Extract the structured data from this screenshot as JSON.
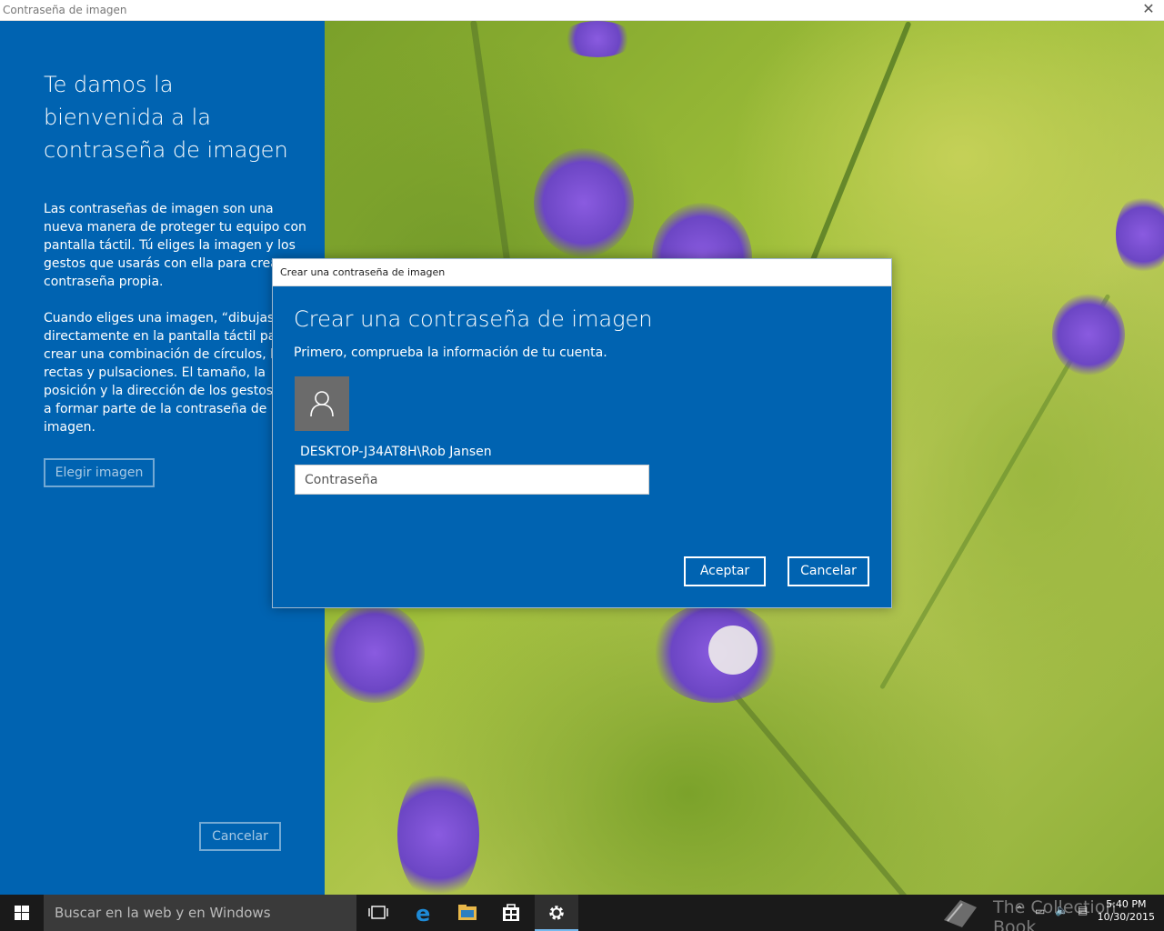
{
  "window": {
    "title": "Contraseña de imagen"
  },
  "left_panel": {
    "heading": "Te damos la bienvenida a la contraseña de imagen",
    "paragraph1": "Las contraseñas de imagen son una nueva manera de proteger tu equipo con pantalla táctil. Tú eliges la imagen y los gestos que usarás con ella para crear una contraseña propia.",
    "paragraph2": "Cuando eliges una imagen, “dibujas” directamente en la pantalla táctil para crear una combinación de círculos, líneas rectas y pulsaciones. El tamaño, la posición y la dirección de los gestos pasan a formar parte de la contraseña de imagen.",
    "choose_button": "Elegir imagen",
    "cancel_button": "Cancelar"
  },
  "dialog": {
    "title": "Crear una contraseña de imagen",
    "heading": "Crear una contraseña de imagen",
    "subtitle": "Primero, comprueba la información de tu cuenta.",
    "username": "DESKTOP-J34AT8H\\Rob Jansen",
    "password_placeholder": "Contraseña",
    "accept_button": "Aceptar",
    "cancel_button": "Cancelar"
  },
  "taskbar": {
    "search_placeholder": "Buscar en la web y en Windows",
    "time": "5:40 PM",
    "date": "10/30/2015",
    "watermark": "The Collection Book"
  }
}
